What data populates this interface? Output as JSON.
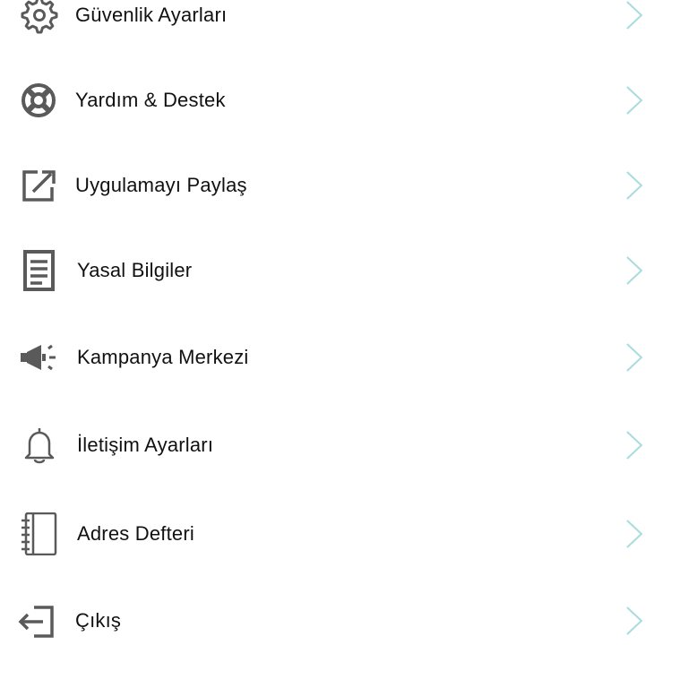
{
  "colors": {
    "icon": "#5a5a5a",
    "chevron": "#a9dcdc",
    "text": "#111111",
    "background": "#ffffff"
  },
  "menu": {
    "items": [
      {
        "label": "Güvenlik Ayarları",
        "icon": "gear-icon"
      },
      {
        "label": "Yardım & Destek",
        "icon": "lifebuoy-icon"
      },
      {
        "label": "Uygulamayı Paylaş",
        "icon": "share-icon"
      },
      {
        "label": "Yasal Bilgiler",
        "icon": "document-icon"
      },
      {
        "label": "Kampanya Merkezi",
        "icon": "megaphone-icon"
      },
      {
        "label": "İletişim Ayarları",
        "icon": "bell-icon"
      },
      {
        "label": "Adres Defteri",
        "icon": "address-book-icon"
      },
      {
        "label": "Çıkış",
        "icon": "logout-icon"
      }
    ]
  }
}
